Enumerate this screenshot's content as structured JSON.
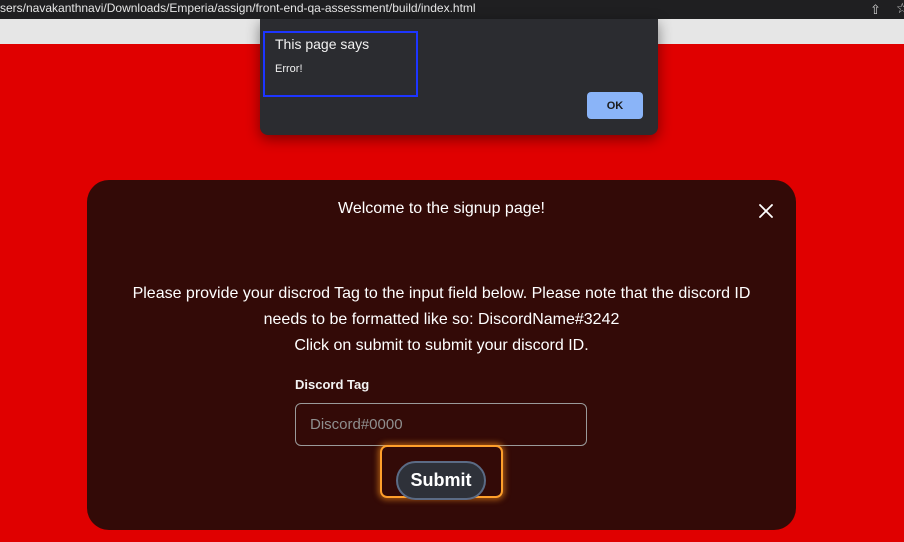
{
  "browser": {
    "url": "sers/navakanthnavi/Downloads/Emperia/assign/front-end-qa-assessment/build/index.html",
    "icons": [
      "share-icon",
      "bookmark-star-icon"
    ]
  },
  "alert": {
    "title": "This page says",
    "message": "Error!",
    "ok_label": "OK"
  },
  "modal": {
    "welcome": "Welcome to the signup page!",
    "instructions": [
      "Please provide your discrod Tag to the input field below. Please note that the discord ID",
      "needs to be formatted like so: DiscordName#3242",
      "Click on submit to submit your discord ID."
    ],
    "field_label": "Discord Tag",
    "field_placeholder": "Discord#0000",
    "field_value": "",
    "submit_label": "Submit"
  },
  "colors": {
    "page_background": "#e00000",
    "modal_background": "#330a07",
    "ok_button": "#8ab4f8",
    "focus_ring": "#ff9f2b",
    "alert_highlight": "#1d35ff"
  }
}
